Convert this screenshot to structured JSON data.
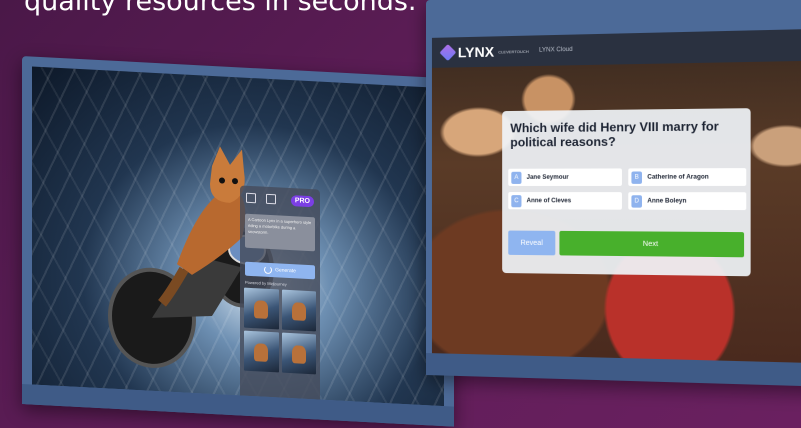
{
  "headline": "quality resources in seconds.",
  "left_board": {
    "ai_panel": {
      "pro_badge": "PRO",
      "prompt": "A Cartoon Lynx in a superhero style riding a motorbike during a snowstorm.",
      "generate_label": "Generate",
      "powered_by": "Powered by Midjourney"
    }
  },
  "right_board": {
    "app": {
      "logo": "LYNX",
      "logo_sub": "CLEVERTOUCH",
      "cloud_label": "LYNX Cloud"
    },
    "quiz": {
      "question": "Which wife did Henry VIII marry for political reasons?",
      "answers": [
        {
          "key": "A",
          "text": "Jane Seymour"
        },
        {
          "key": "B",
          "text": "Catherine of Aragon"
        },
        {
          "key": "C",
          "text": "Anne of Cleves"
        },
        {
          "key": "D",
          "text": "Anne Boleyn"
        }
      ],
      "reveal_label": "Reveal",
      "next_label": "Next"
    }
  },
  "colors": {
    "background": "#5e1d57",
    "bezel": "#4c6a98",
    "accent_blue": "#8fb5f0",
    "next_green": "#48b02c",
    "pro_purple": "#7b3fe4"
  }
}
